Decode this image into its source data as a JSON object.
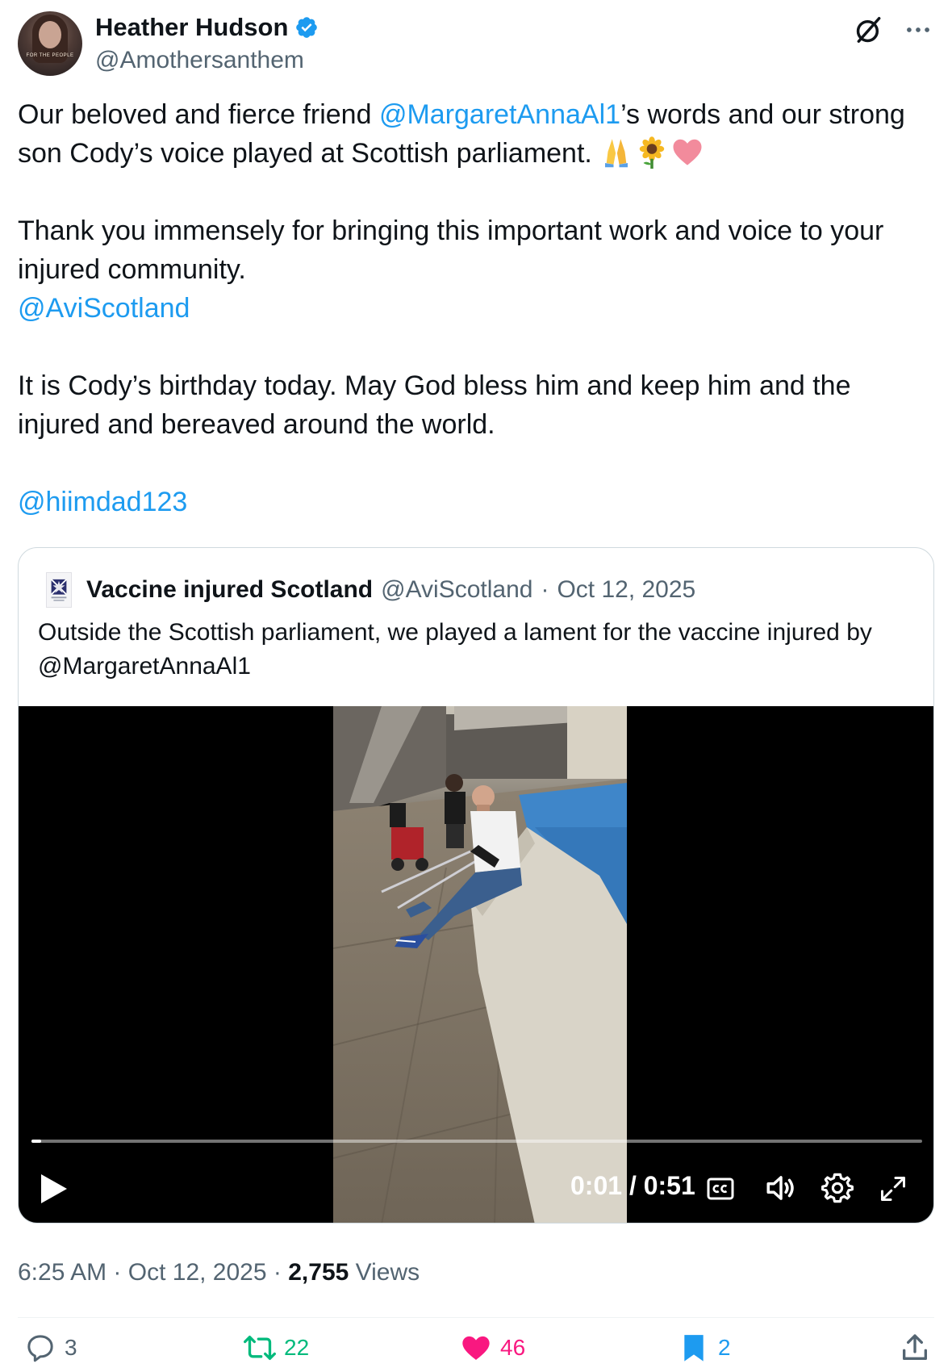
{
  "author": {
    "display_name": "Heather Hudson",
    "handle": "@Amothersanthem",
    "avatar_caption": "FOR THE PEOPLE",
    "verified": true
  },
  "tweet": {
    "p1_a": "Our beloved and fierce friend ",
    "p1_mention": "@MargaretAnnaAl1",
    "p1_b": "’s words and our strong son Cody’s voice played at Scottish parliament. ",
    "p1_emojis": [
      "folded-hands",
      "sunflower",
      "pink-heart"
    ],
    "p2": "Thank you immensely for bringing this important work and voice to your injured community.",
    "p2_mention": "@AviScotland",
    "p3": "It is Cody’s birthday today. May God bless him and keep him and the injured and bereaved around the world.",
    "p4_mention": "@hiimdad123"
  },
  "quote": {
    "name": "Vaccine injured Scotland",
    "handle": "@AviScotland",
    "dot": "·",
    "date": "Oct 12, 2025",
    "text": "Outside the Scottish parliament, we played a lament for the vaccine injured by @MargaretAnnaAl1",
    "video": {
      "current_time": "0:01",
      "separator": "/",
      "duration": "0:51",
      "progress_fraction": 0.011
    }
  },
  "meta": {
    "time": "6:25 AM",
    "dot": "·",
    "date": "Oct 12, 2025",
    "views_count": "2,755",
    "views_label": "Views"
  },
  "actions": {
    "replies": "3",
    "reposts": "22",
    "likes": "46",
    "bookmarks": "2"
  },
  "colors": {
    "link": "#1d9bf0",
    "secondary_text": "#536471",
    "repost": "#00ba7c",
    "like": "#f91880"
  }
}
